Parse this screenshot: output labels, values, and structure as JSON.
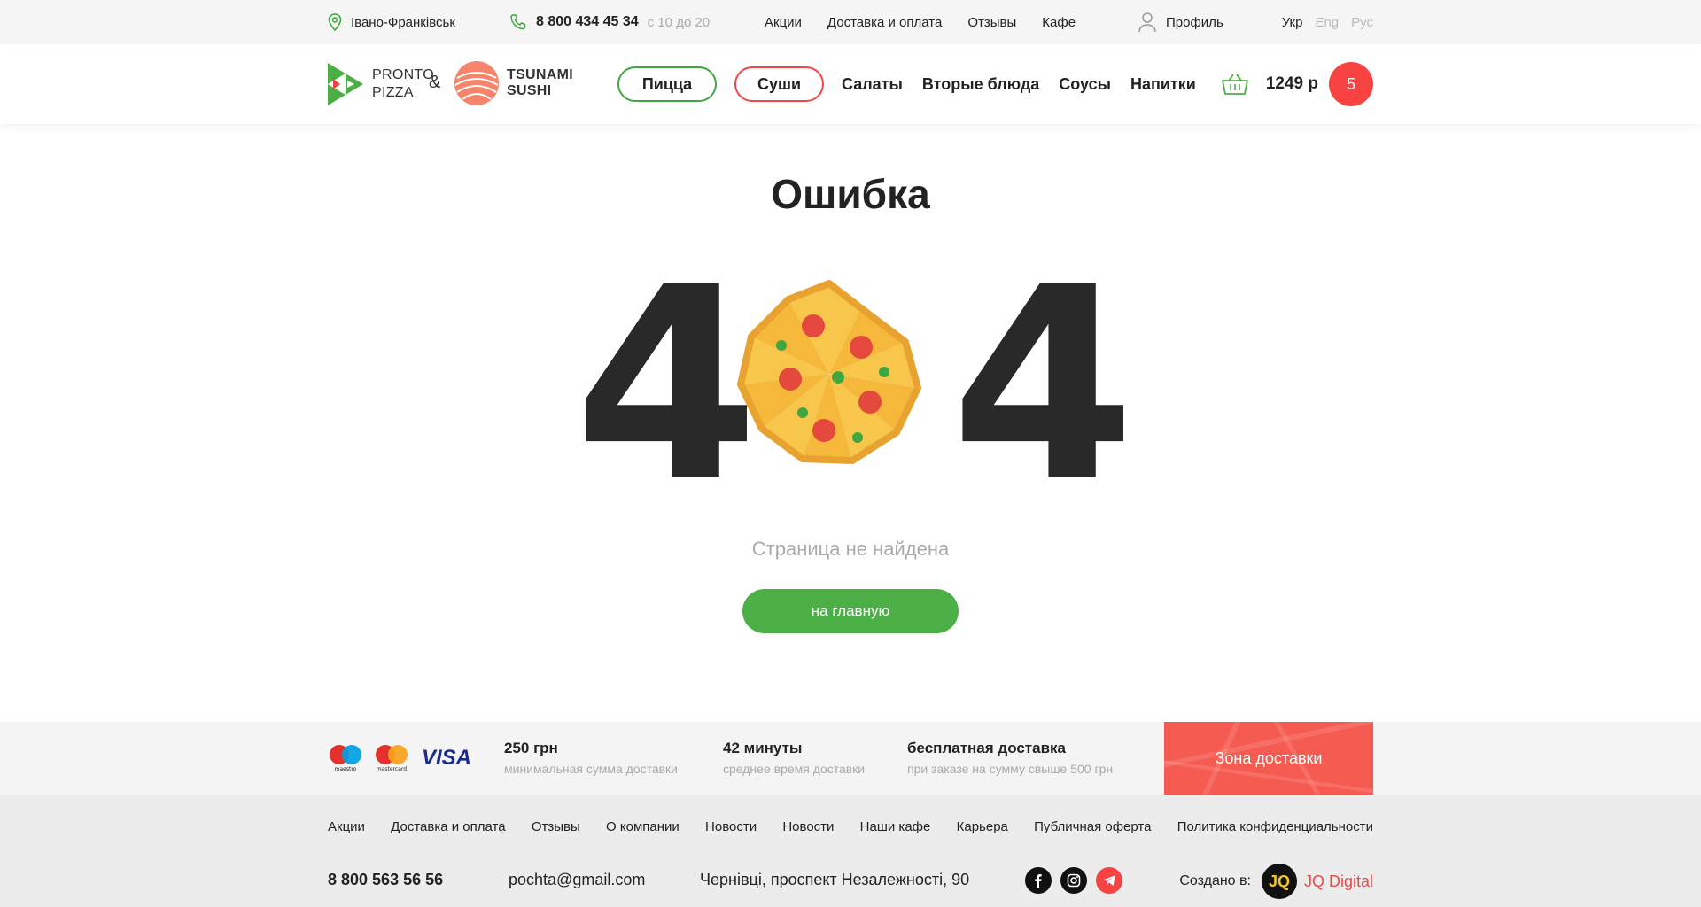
{
  "topbar": {
    "city": "Івано-Франківськ",
    "phone": "8 800 434 45 34",
    "hours": "с 10 до 20",
    "nav": [
      "Акции",
      "Доставка и оплата",
      "Отзывы",
      "Кафе"
    ],
    "profile": "Профиль",
    "languages": [
      "Укр",
      "Eng",
      "Рус"
    ],
    "active_language": "Укр"
  },
  "header": {
    "logo_pronto": [
      "PRONTO",
      "PIZZA"
    ],
    "amp": "&",
    "logo_tsunami": [
      "TSUNAMI",
      "SUSHI"
    ],
    "nav_pizza": "Пицца",
    "nav_sushi": "Суши",
    "nav": [
      "Салаты",
      "Вторые блюда",
      "Соусы",
      "Напитки"
    ],
    "cart_total": "1249 р",
    "cart_count": "5",
    "cart_icon": "basket-icon"
  },
  "error": {
    "title": "Ошибка",
    "digit_left": "4",
    "digit_right": "4",
    "zero_icon": "pizza-icon",
    "subtitle": "Страница не найдена",
    "button": "на главную"
  },
  "strip": {
    "cards": [
      "maestro",
      "mastercard",
      "VISA"
    ],
    "info": [
      {
        "big": "250 грн",
        "small": "минимальная сумма доставки"
      },
      {
        "big": "42 минуты",
        "small": "среднее время доставки"
      },
      {
        "big": "бесплатная доставка",
        "small": "при заказе на сумму свыше 500 грн"
      }
    ],
    "zone": "Зона доставки"
  },
  "footer": {
    "links": [
      "Акции",
      "Доставка и оплата",
      "Отзывы",
      "О компании",
      "Новости",
      "Новости",
      "Наши кафе",
      "Карьера",
      "Публичная оферта",
      "Политика конфиденциальности"
    ],
    "phone": "8 800 563 56 56",
    "email": "pochta@gmail.com",
    "address": "Чернівці, проспект Незалежності, 90",
    "social": [
      "facebook-icon",
      "instagram-icon",
      "telegram-icon"
    ],
    "credit_label": "Создано в:",
    "credit_logo": "JQ",
    "credit_brand": "JQ Digital"
  },
  "colors": {
    "green": "#4caf46",
    "red": "#f94343",
    "dark": "#292929"
  }
}
